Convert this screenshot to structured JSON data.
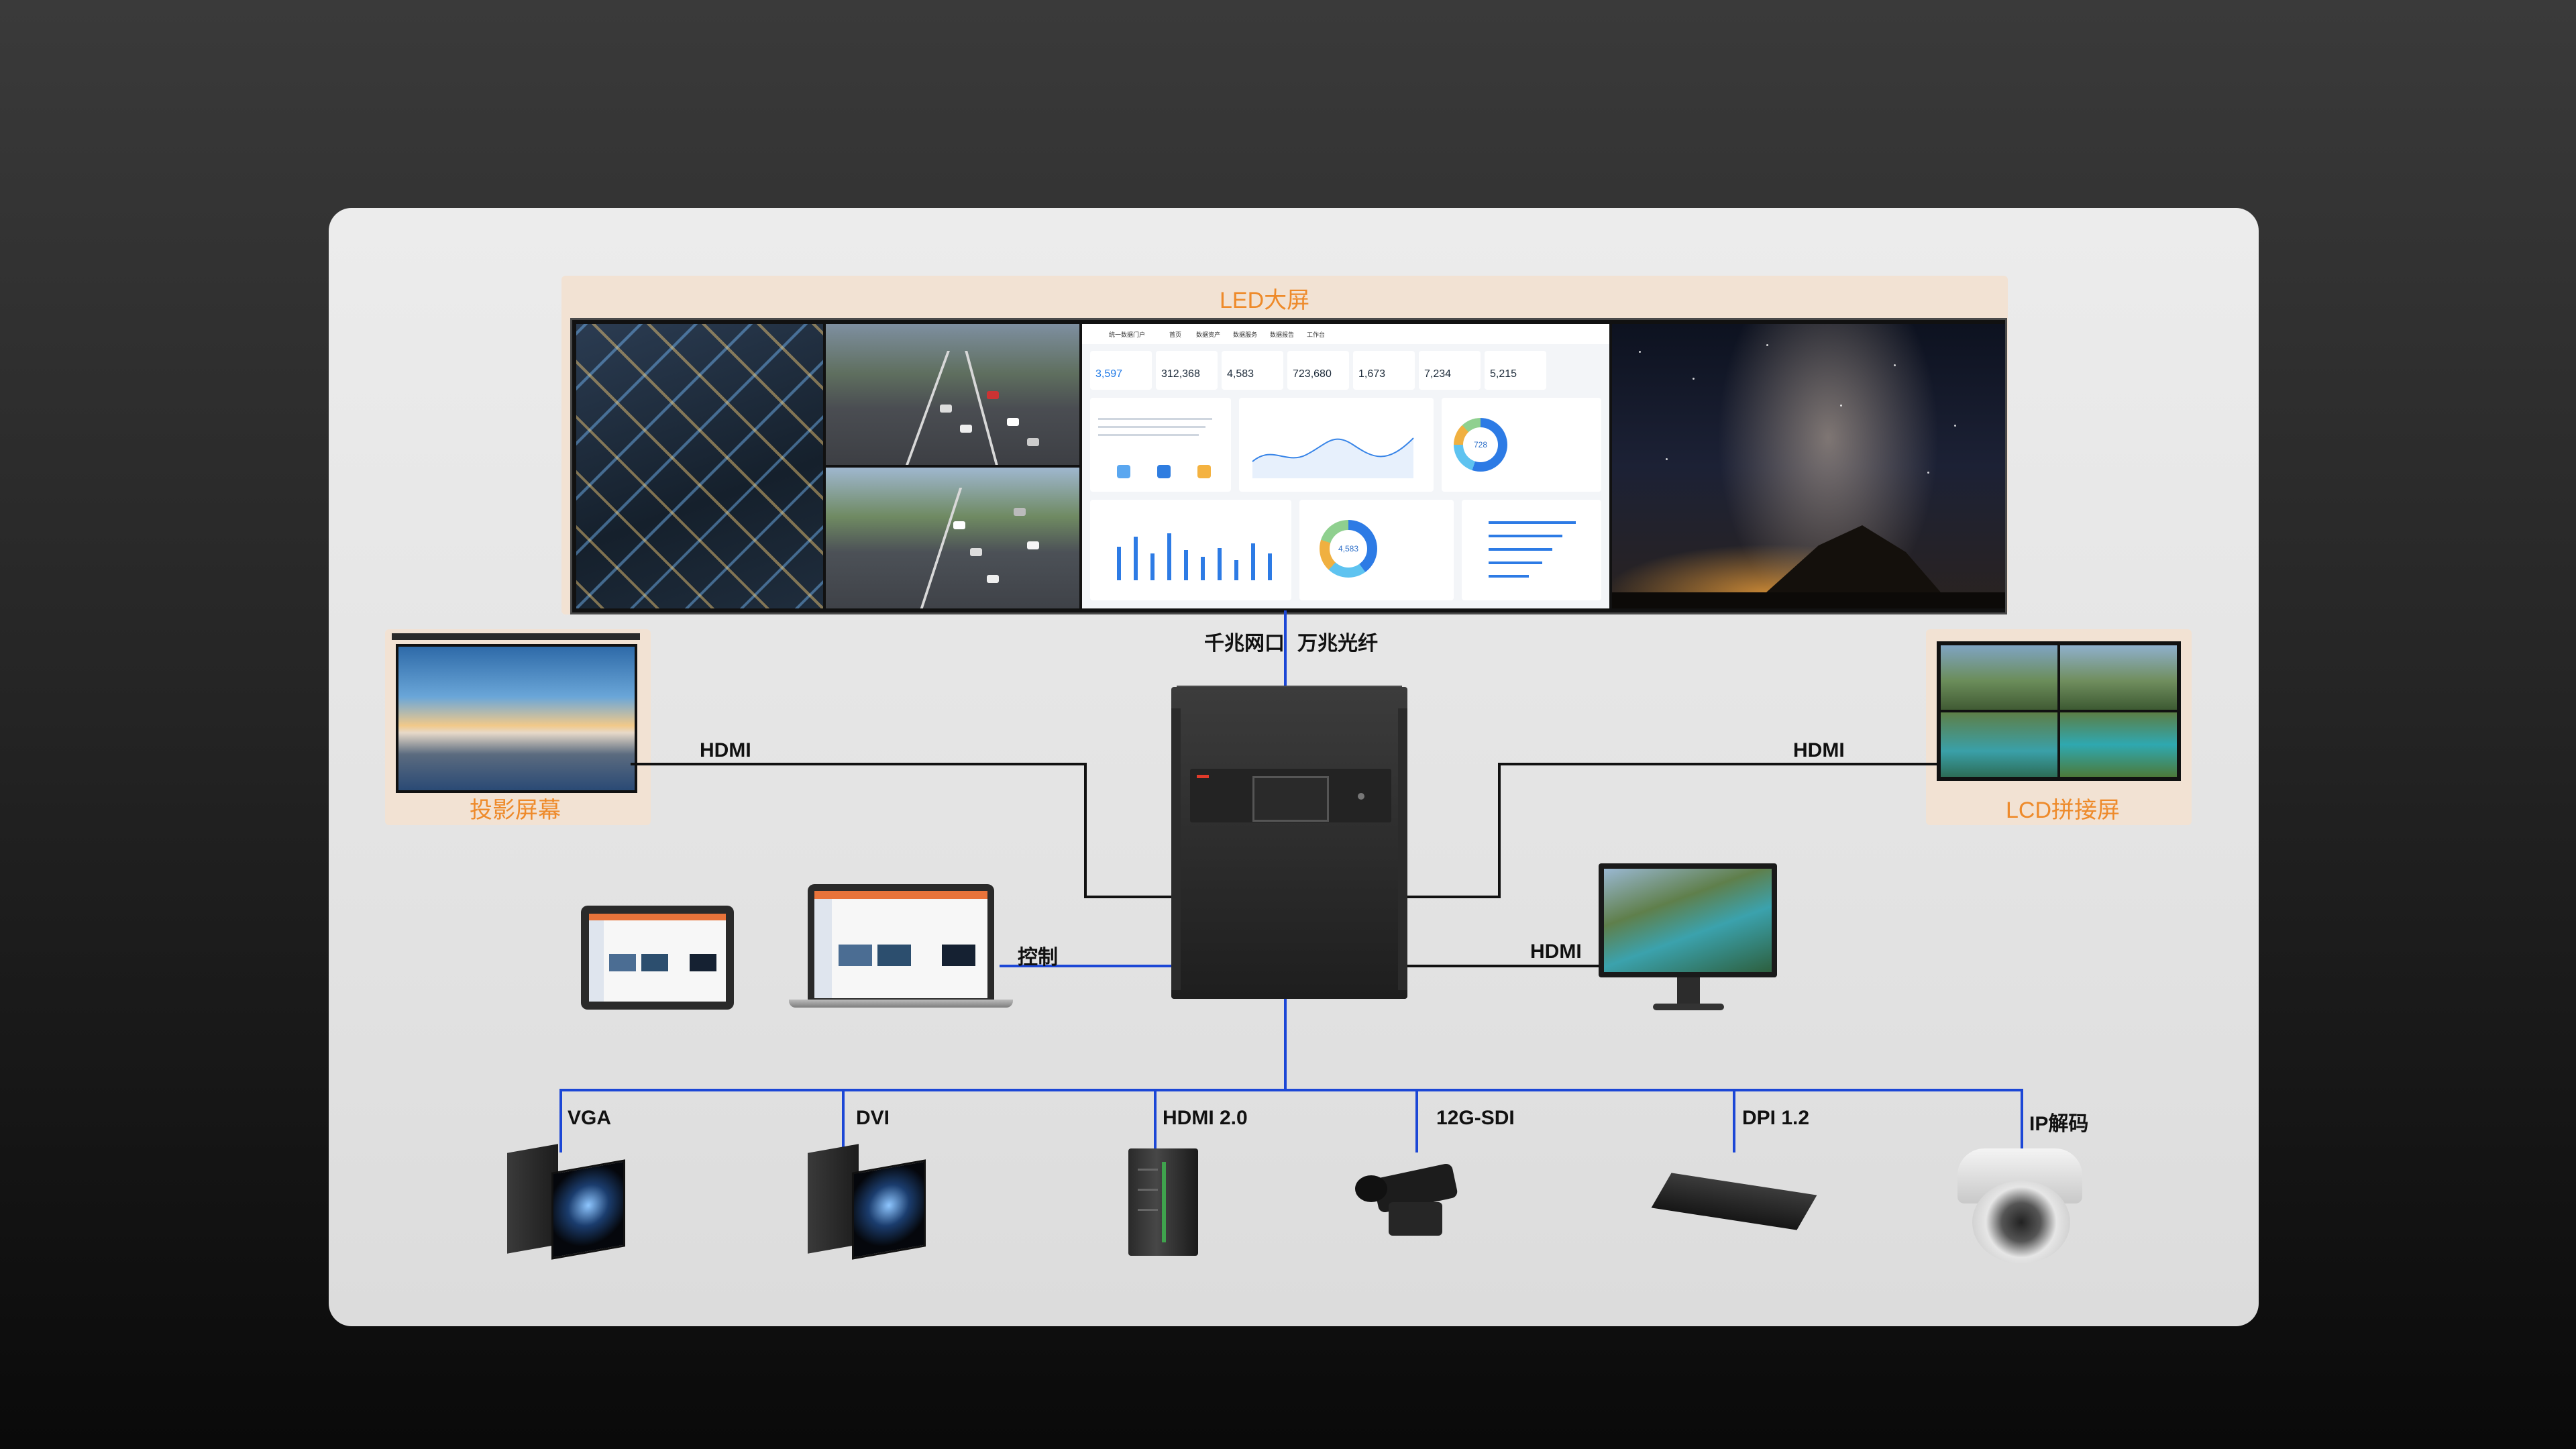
{
  "diagram": {
    "led_wall": {
      "title": "LED大屏",
      "dashboard": {
        "nav": [
          "统一数据门户",
          "首页",
          "数据资产",
          "数据服务",
          "数据报告",
          "工作台"
        ],
        "kpis": [
          "3,597",
          "312,368",
          "4,583",
          "723,680",
          "1,673",
          "7,234",
          "5,215"
        ],
        "donut_values": [
          "728",
          "4,583"
        ]
      }
    },
    "projection_screen": {
      "label": "投影屏幕"
    },
    "lcd_splice": {
      "label": "LCD拼接屏"
    },
    "links": {
      "top_left": "千兆网口",
      "top_right": "万兆光纤",
      "hdmi_projection": "HDMI",
      "hdmi_lcd": "HDMI",
      "control": "控制",
      "hdmi_monitor": "HDMI"
    },
    "inputs": [
      {
        "label": "VGA",
        "device": "projector-camera"
      },
      {
        "label": "DVI",
        "device": "projector-camera"
      },
      {
        "label": "HDMI 2.0",
        "device": "server"
      },
      {
        "label": "12G-SDI",
        "device": "video-camera"
      },
      {
        "label": "DPI 1.2",
        "device": "decoder-box"
      },
      {
        "label": "IP解码",
        "device": "dome-camera"
      }
    ],
    "colors": {
      "accent": "#ee8a2a",
      "blue_line": "#1c47d6",
      "black_line": "#111111"
    }
  }
}
